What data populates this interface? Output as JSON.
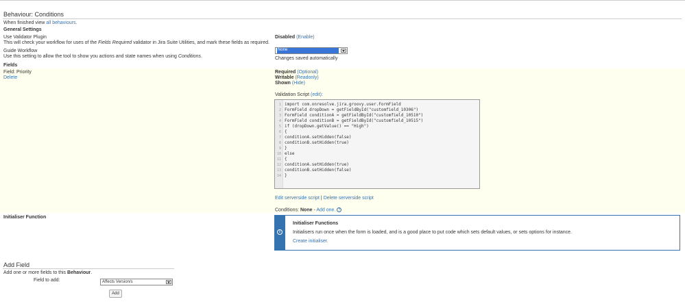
{
  "header": {
    "title": "Behaviour: Conditions",
    "finished_prefix": "When finished view",
    "finished_link": "all behaviours."
  },
  "general": {
    "heading": "General Settings",
    "validator_label": "Use Validator Plugin",
    "validator_desc_before": "This will check your workflow for uses of the",
    "validator_desc_italic": "Fields Required",
    "validator_desc_after": "validator in Jira Suite Utilities, and mark these fields as required.",
    "validator_state": "Disabled",
    "validator_action": "(Enable)",
    "guide_label": "Guide Workflow",
    "guide_desc_before": "Use this setting to allow the tool to show you actions and state names when using",
    "guide_desc_italic": "Conditions",
    "guide_desc_after": ".",
    "guide_select_value": "None",
    "guide_saved": "Changes saved automatically"
  },
  "fields": {
    "heading": "Fields",
    "field_label": "Field: Priority",
    "delete_link": "Delete",
    "required_label": "Required",
    "required_action": "(Optional)",
    "writable_label": "Writable",
    "writable_action": "(Readonly)",
    "shown_label": "Shown",
    "shown_action": "(Hide)",
    "script_label": "Validation Script",
    "script_edit": "(edit):",
    "code_lines": [
      "import com.onresolve.jira.groovy.user.FormField",
      "FormField dropDown = getFieldById(\"customfield_10306\")",
      "FormField conditionA = getFieldById(\"customfield_10510\")",
      "FormField conditionB = getFieldById(\"customfield_10515\")",
      "if (dropDown.getValue() == \"High\")",
      "{",
      "conditionA.setHidden(false)",
      "conditionB.setHidden(true)",
      "}",
      "else",
      "{",
      "conditionA.setHidden(true)",
      "conditionB.setHidden(false)",
      "}"
    ],
    "edit_server": "Edit serverside script",
    "sep": "|",
    "delete_server": "Delete serverside script",
    "conditions_label": "Conditions:",
    "conditions_value": "None",
    "conditions_dash": "-",
    "add_one": "Add one."
  },
  "initialiser": {
    "label": "Initialiser Function",
    "box_title": "Initialiser Functions",
    "box_desc": "Initialisers run once when the form is loaded, and is a good place to put code which sets default values, or sets options for instance.",
    "create_link": "Create initialiser."
  },
  "add_field": {
    "heading": "Add Field",
    "desc_before": "Add one or more fields to this",
    "desc_bold": "Behaviour",
    "desc_after": ".",
    "field_to_add": "Field to add:",
    "select_value": "Affects Version/s",
    "add_button": "Add"
  },
  "colors": {
    "link": "#3572b0",
    "highlight": "#fffff0",
    "select_selected": "#3875d7"
  }
}
